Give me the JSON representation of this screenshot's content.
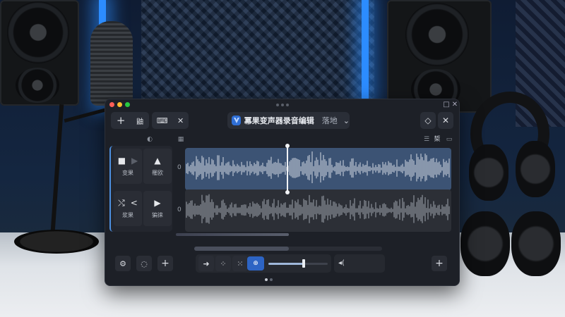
{
  "app": {
    "title": "冪果变声器录音编辑",
    "subtitle": "落地",
    "window_controls": {
      "restore": "□",
      "close": "✕"
    }
  },
  "toolbar": {
    "add_label": "+",
    "link_label": "鼬",
    "keyboard_label": "⌨",
    "close_label": "✕",
    "diamond_label": "◇",
    "dismiss_label": "✕",
    "dropdown_chevron": "⌄"
  },
  "subbar": {
    "right_label": "椞"
  },
  "track_controls": {
    "row1": [
      {
        "icon": "stop-icon",
        "glyph": "■",
        "label": "变果"
      },
      {
        "icon": "navigate-icon",
        "glyph": "▲",
        "label": "罹欧"
      }
    ],
    "row2": [
      {
        "icon": "shuffle-icon",
        "glyph": "⤭",
        "label": "浆果"
      },
      {
        "icon": "play-icon",
        "glyph": "▶",
        "label": "猵徕"
      }
    ],
    "disabled_play_glyph": "▶",
    "share_glyph": "<"
  },
  "tracks": [
    {
      "offset_label": "0"
    },
    {
      "offset_label": "0"
    }
  ],
  "bottombar": {
    "settings_glyph": "⚙",
    "refresh_glyph": "◌",
    "add_glyph": "+",
    "arrow_glyph": "➜",
    "grid_glyph": "⁘",
    "snap_glyph": "⁙",
    "active_label": "⊕",
    "volume_label": "◂(",
    "right_add_glyph": "+"
  },
  "volume_level": 0.6,
  "colors": {
    "accent": "#2d64c4",
    "track_selected": "#3c5374",
    "window_bg": "#1d2027"
  }
}
